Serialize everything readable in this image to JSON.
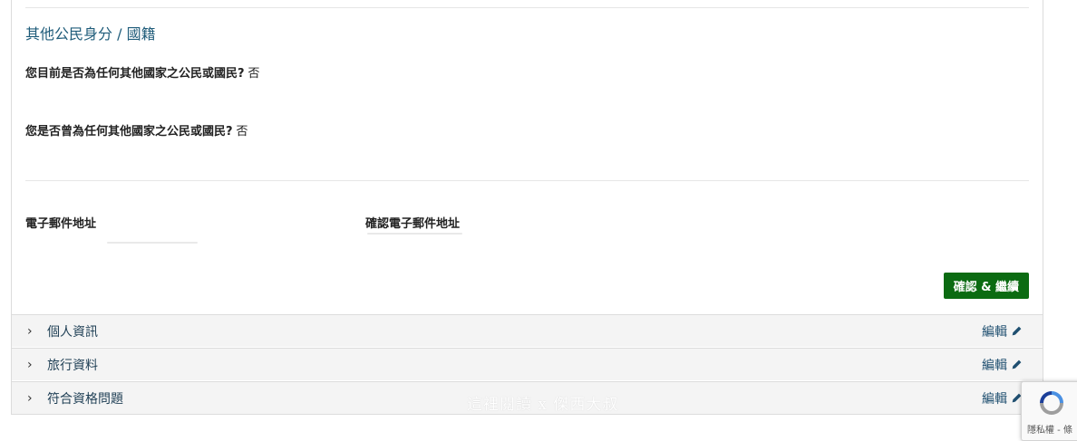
{
  "section": {
    "title": "其他公民身分 / 國籍"
  },
  "questions": [
    {
      "question": "您目前是否為任何其他國家之公民或國民?",
      "answer": "否"
    },
    {
      "question": "您是否曾為任何其他國家之公民或國民?",
      "answer": "否"
    }
  ],
  "email": {
    "label": "電子郵件地址",
    "confirm_label": "確認電子郵件地址"
  },
  "buttons": {
    "confirm": "確認 & 繼續"
  },
  "accordion": [
    {
      "title": "個人資訊",
      "edit": "編輯"
    },
    {
      "title": "旅行資料",
      "edit": "編輯"
    },
    {
      "title": "符合資格問題",
      "edit": "編輯"
    }
  ],
  "watermark": "這裡閱讀 x 傑西大叔",
  "recaptcha": {
    "footer": "隱私權 - 條"
  },
  "colors": {
    "section_title": "#1f5c7a",
    "confirm_button": "#0b6b12",
    "accordion_bg": "#f4f4f4"
  },
  "icons": {
    "chevron": "chevron-right-icon",
    "edit": "pencil-icon",
    "recaptcha": "recaptcha-icon"
  }
}
